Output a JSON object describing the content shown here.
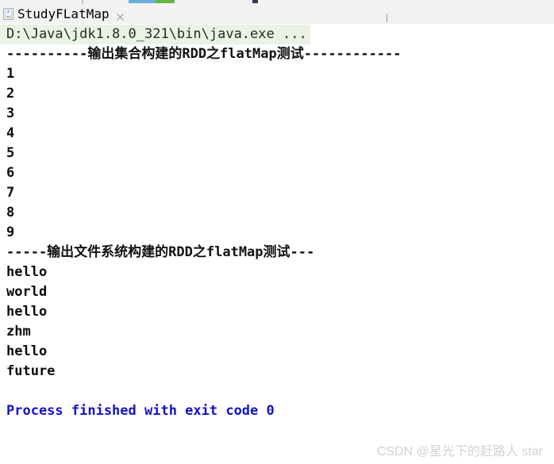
{
  "window": {
    "background_color": "#ffffff",
    "toolbar_fragments": [
      {
        "name": "run-icon-fragment",
        "color": "#6aaee0"
      },
      {
        "name": "run-icon-fragment-2",
        "color": "#62b548"
      },
      {
        "name": "debug-icon-fragment",
        "color": "#2a3a55"
      }
    ]
  },
  "tab_bar": {
    "active_tab": {
      "label": "StudyFLatMap",
      "close_label": "×",
      "file_icon": "java-file-icon",
      "underline_color": "#4b6a95"
    }
  },
  "console": {
    "lines": [
      {
        "kind": "cmd",
        "text": "D:\\Java\\jdk1.8.0_321\\bin\\java.exe ...",
        "color": "#1f2d1f",
        "background": "#e9f2e4"
      },
      {
        "kind": "sep",
        "text": "----------输出集合构建的RDD之flatMap测试------------",
        "color": "#111111"
      },
      {
        "kind": "num",
        "text": "1",
        "color": "#0b0b0b"
      },
      {
        "kind": "num",
        "text": "2",
        "color": "#0b0b0b"
      },
      {
        "kind": "num",
        "text": "3",
        "color": "#0b0b0b"
      },
      {
        "kind": "num",
        "text": "4",
        "color": "#0b0b0b"
      },
      {
        "kind": "num",
        "text": "5",
        "color": "#0b0b0b"
      },
      {
        "kind": "num",
        "text": "6",
        "color": "#0b0b0b"
      },
      {
        "kind": "num",
        "text": "7",
        "color": "#0b0b0b"
      },
      {
        "kind": "num",
        "text": "8",
        "color": "#0b0b0b"
      },
      {
        "kind": "num",
        "text": "9",
        "color": "#0b0b0b"
      },
      {
        "kind": "sep",
        "text": "-----输出文件系统构建的RDD之flatMap测试---",
        "color": "#111111"
      },
      {
        "kind": "word",
        "text": "hello",
        "color": "#0b0b0b"
      },
      {
        "kind": "word",
        "text": "world",
        "color": "#0b0b0b"
      },
      {
        "kind": "word",
        "text": "hello",
        "color": "#0b0b0b"
      },
      {
        "kind": "word",
        "text": "zhm",
        "color": "#0b0b0b"
      },
      {
        "kind": "word",
        "text": "hello",
        "color": "#0b0b0b"
      },
      {
        "kind": "word",
        "text": "future",
        "color": "#0b0b0b"
      },
      {
        "kind": "blank",
        "text": " ",
        "color": "#ffffff"
      },
      {
        "kind": "exit",
        "text": "Process finished with exit code 0",
        "color": "#1212c8"
      }
    ]
  },
  "watermark": {
    "text": "CSDN @星光下的赶路人 star",
    "color": "#d2d2d2"
  }
}
